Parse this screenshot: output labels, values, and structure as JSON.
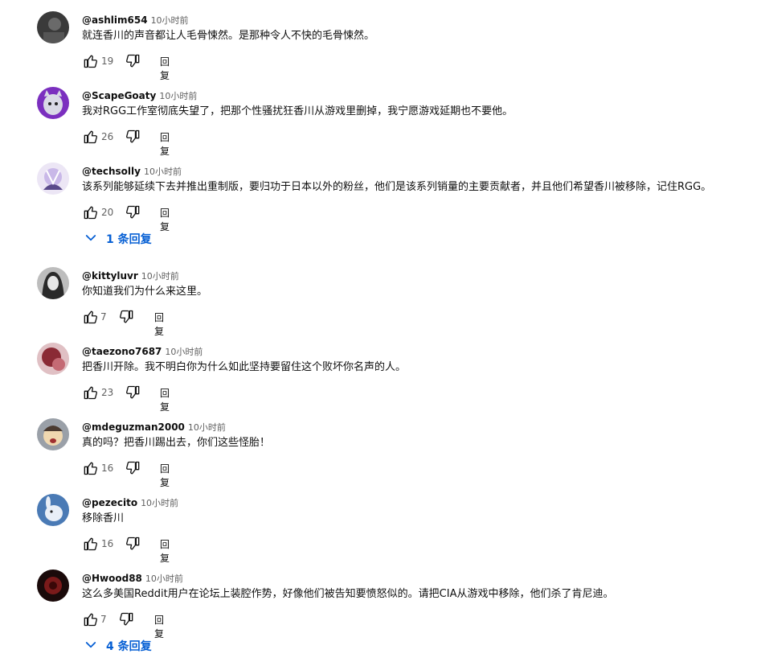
{
  "actions": {
    "reply_label": "回复"
  },
  "comments": [
    {
      "author": "@ashlim654",
      "time": "10小时前",
      "text": "就连香川的声音都让人毛骨悚然。是那种令人不快的毛骨悚然。",
      "likes": "19",
      "avatar_colors": [
        "#3a3a3a",
        "#6a6a6a"
      ]
    },
    {
      "author": "@ScapeGoaty",
      "time": "10小时前",
      "text": "我对RGG工作室彻底失望了，把那个性骚扰狂香川从游戏里删掉，我宁愿游戏延期也不要他。",
      "likes": "26",
      "avatar_colors": [
        "#7b2fbf",
        "#d9d9e6"
      ]
    },
    {
      "author": "@techsolly",
      "time": "10小时前",
      "text": "该系列能够延续下去并推出重制版，要归功于日本以外的粉丝，他们是该系列销量的主要贡献者，并且他们希望香川被移除，记住RGG。",
      "likes": "20",
      "avatar_colors": [
        "#c9b8e8",
        "#5a4a8a"
      ]
    },
    {
      "author": "@kittyluvr",
      "time": "10小时前",
      "text": "你知道我们为什么来这里。",
      "likes": "7",
      "avatar_colors": [
        "#2a2a2a",
        "#bdbdbd"
      ]
    },
    {
      "author": "@taezono7687",
      "time": "10小时前",
      "text": "把香川开除。我不明白你为什么如此坚持要留住这个败坏你名声的人。",
      "likes": "23",
      "avatar_colors": [
        "#8a2a35",
        "#e0c0c4"
      ]
    },
    {
      "author": "@mdeguzman2000",
      "time": "10小时前",
      "text": "真的吗？把香川踢出去，你们这些怪胎！",
      "likes": "16",
      "avatar_colors": [
        "#4a3a30",
        "#f0d8b0"
      ]
    },
    {
      "author": "@pezecito",
      "time": "10小时前",
      "text": "移除香川",
      "likes": "16",
      "avatar_colors": [
        "#4a7ab5",
        "#e8eef7"
      ]
    },
    {
      "author": "@Hwood88",
      "time": "10小时前",
      "text": "这么多美国Reddit用户在论坛上装腔作势，好像他们被告知要愤怒似的。请把CIA从游戏中移除，他们杀了肯尼迪。",
      "likes": "7",
      "avatar_colors": [
        "#1a0a0a",
        "#7a1a1a"
      ]
    }
  ],
  "reply_toggles": [
    {
      "label": "1 条回复"
    },
    {
      "label": "4 条回复"
    }
  ],
  "accent_color": "#065fd4"
}
